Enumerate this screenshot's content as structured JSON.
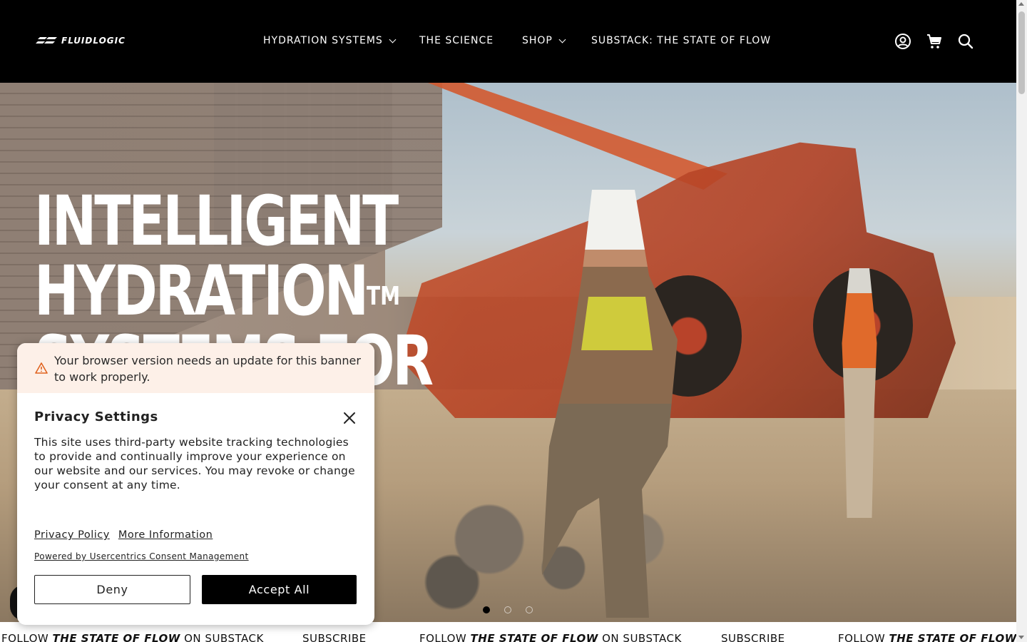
{
  "header": {
    "logo_text": "FLUIDLOGIC",
    "nav": [
      {
        "label": "HYDRATION SYSTEMS",
        "has_dropdown": true
      },
      {
        "label": "THE SCIENCE",
        "has_dropdown": false
      },
      {
        "label": "SHOP",
        "has_dropdown": true
      },
      {
        "label": "SUBSTACK: THE STATE OF FLOW",
        "has_dropdown": false
      }
    ],
    "icons": [
      "account-icon",
      "cart-icon",
      "search-icon"
    ]
  },
  "hero": {
    "line1": "INTELLIGENT",
    "line2": "HYDRATION",
    "trademark": "TM",
    "line3": "SYSTEMS FOR",
    "slides_count": 3,
    "active_slide": 1
  },
  "ticker": {
    "prefix": "FOLLOW",
    "emphasis": "THE STATE OF FLOW",
    "suffix": "ON SUBSTACK",
    "subscribe": "SUBSCRIBE"
  },
  "consent": {
    "warning": "Your browser version needs an update for this banner to work properly.",
    "title": "Privacy Settings",
    "body": "This site uses third-party website tracking technologies to provide and continually improve your experience on our website and our services. You may revoke or change your consent at any time.",
    "privacy_policy": "Privacy Policy",
    "more_information": "More Information",
    "powered_by": "Powered by Usercentrics Consent Management",
    "deny": "Deny",
    "accept_all": "Accept All"
  },
  "colors": {
    "header_bg": "#000000",
    "warning_bg": "#fdf0e8",
    "accent_warn": "#e0631f"
  }
}
